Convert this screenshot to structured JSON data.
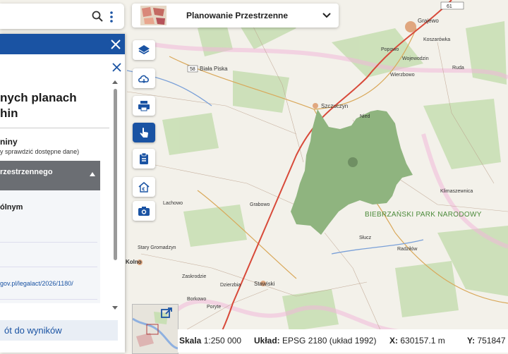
{
  "search_panel": {
    "search_icon": "search-icon",
    "menu_icon": "kebab-icon"
  },
  "side_panel": {
    "title": "nych planach\nhin",
    "subtitle": "niny",
    "subtitle_note": "y sprawdzić dostępne dane)",
    "accordion_label": "rzestrzennego",
    "accordion_item": "ólnym",
    "link_text": "gov.pl/legalact/2026/1180/",
    "back_button": "ót do wyników"
  },
  "title_bar": {
    "title": "Planowanie Przestrzenne"
  },
  "tools": [
    {
      "name": "layers-icon"
    },
    {
      "name": "cloud-icon"
    },
    {
      "name": "print-icon"
    },
    {
      "name": "touch-icon"
    },
    {
      "name": "clipboard-icon"
    },
    {
      "name": "euro-house-icon"
    },
    {
      "name": "camera-icon"
    }
  ],
  "status": {
    "scale_label": "Skala",
    "scale_value": "1:250 000",
    "crs_label": "Układ:",
    "crs_value": "EPSG 2180 (układ 1992)",
    "x_label": "X:",
    "x_value": "630157.1 m",
    "y_label": "Y:",
    "y_value": "751847"
  },
  "map_labels": {
    "grajewo": "Grajewo",
    "koszarowka": "Koszarówka",
    "popowo": "Popowo",
    "wojewodzin": "Wojewodzin",
    "ruda": "Ruda",
    "wierzbowo": "Wierzbowo",
    "biala_piska": "Biała Piska",
    "szczuczyn": "Szczuczyn",
    "niedz": "Nied",
    "klimaszewnica": "Klimaszewnica",
    "lachowo": "Lachowo",
    "grabowo": "Grabowo",
    "park": "BIEBRZAŃSKI PARK NARODOWY",
    "sluc": "Słucz",
    "radzilow": "Radziłów",
    "stary_gromadzyn": "Stary Gromadzyn",
    "kolno": "Kolno",
    "zaskrodzie": "Zaskrodzie",
    "dzierzbia": "Dzierzbia",
    "stawiski": "Stawiski",
    "borkowo": "Borkowo",
    "poryte": "Poryte",
    "route_58": "58",
    "route_61": "61"
  },
  "colors": {
    "accent": "#1a53a3",
    "park": "#8fb47f",
    "road": "#d84a3a"
  }
}
